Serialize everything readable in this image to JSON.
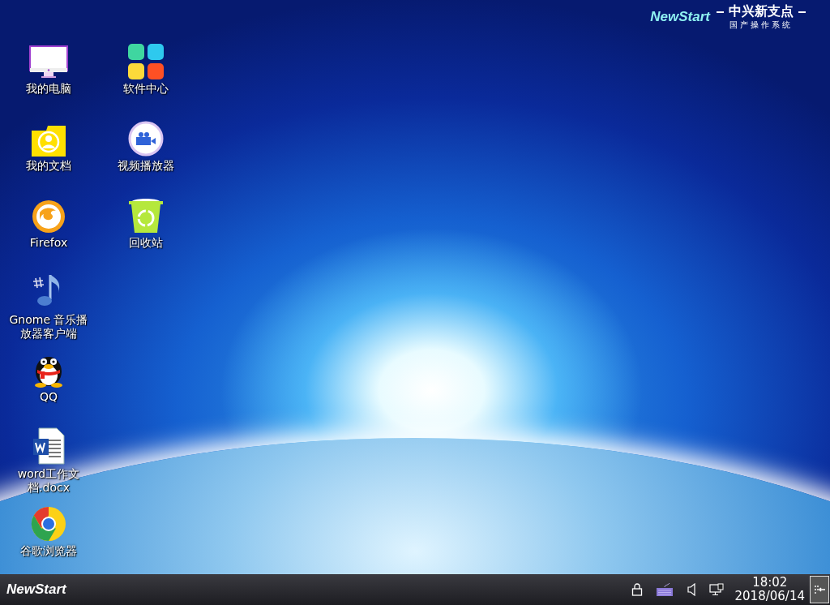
{
  "wallpaper": {
    "logo_text": "NewStart",
    "brand": "中兴新支点",
    "tagline": "国产操作系统"
  },
  "desktop_icons": [
    {
      "kind": "computer",
      "label": "我的电脑"
    },
    {
      "kind": "documents",
      "label": "我的文档"
    },
    {
      "kind": "firefox",
      "label": "Firefox"
    },
    {
      "kind": "music",
      "label": "Gnome 音乐播放器客户端"
    },
    {
      "kind": "qq",
      "label": "QQ"
    },
    {
      "kind": "word",
      "label": "word工作文档.docx"
    },
    {
      "kind": "chrome",
      "label": "谷歌浏览器"
    },
    {
      "kind": "apps",
      "label": "软件中心"
    },
    {
      "kind": "video",
      "label": "视频播放器"
    },
    {
      "kind": "trash",
      "label": "回收站"
    }
  ],
  "taskbar": {
    "start_label": "NewStart",
    "tray": [
      {
        "kind": "lock"
      },
      {
        "kind": "keyboard"
      },
      {
        "kind": "speaker"
      },
      {
        "kind": "network"
      }
    ],
    "clock": {
      "time": "18:02",
      "date": "2018/06/14"
    }
  }
}
